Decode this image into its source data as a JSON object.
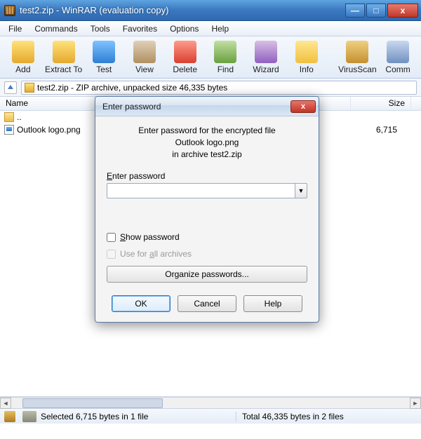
{
  "window": {
    "title": "test2.zip - WinRAR (evaluation copy)"
  },
  "menu": {
    "file": "File",
    "commands": "Commands",
    "tools": "Tools",
    "favorites": "Favorites",
    "options": "Options",
    "help": "Help"
  },
  "toolbar": {
    "add": "Add",
    "extract": "Extract To",
    "test": "Test",
    "view": "View",
    "delete": "Delete",
    "find": "Find",
    "wizard": "Wizard",
    "info": "Info",
    "virus": "VirusScan",
    "comm": "Comm"
  },
  "address": {
    "path": "test2.zip - ZIP archive, unpacked size 46,335 bytes"
  },
  "columns": {
    "name": "Name",
    "size": "Size"
  },
  "rows": [
    {
      "name": "..",
      "size": "",
      "type": "folder"
    },
    {
      "name": "Outlook logo.png",
      "size": "6,715",
      "type": "img"
    }
  ],
  "status": {
    "selected": "Selected 6,715 bytes in 1 file",
    "total": "Total 46,335 bytes in 2 files"
  },
  "dialog": {
    "title": "Enter password",
    "msg_line1": "Enter password for the encrypted file",
    "msg_line2": "Outlook logo.png",
    "msg_line3": "in archive test2.zip",
    "pw_label_pre": "E",
    "pw_label_post": "nter password",
    "show_pre": "S",
    "show_post": "how password",
    "use_pre": "Use for ",
    "use_mid": "a",
    "use_post": "ll archives",
    "organize": "Organize passwords...",
    "ok": "OK",
    "cancel": "Cancel",
    "help": "Help"
  }
}
